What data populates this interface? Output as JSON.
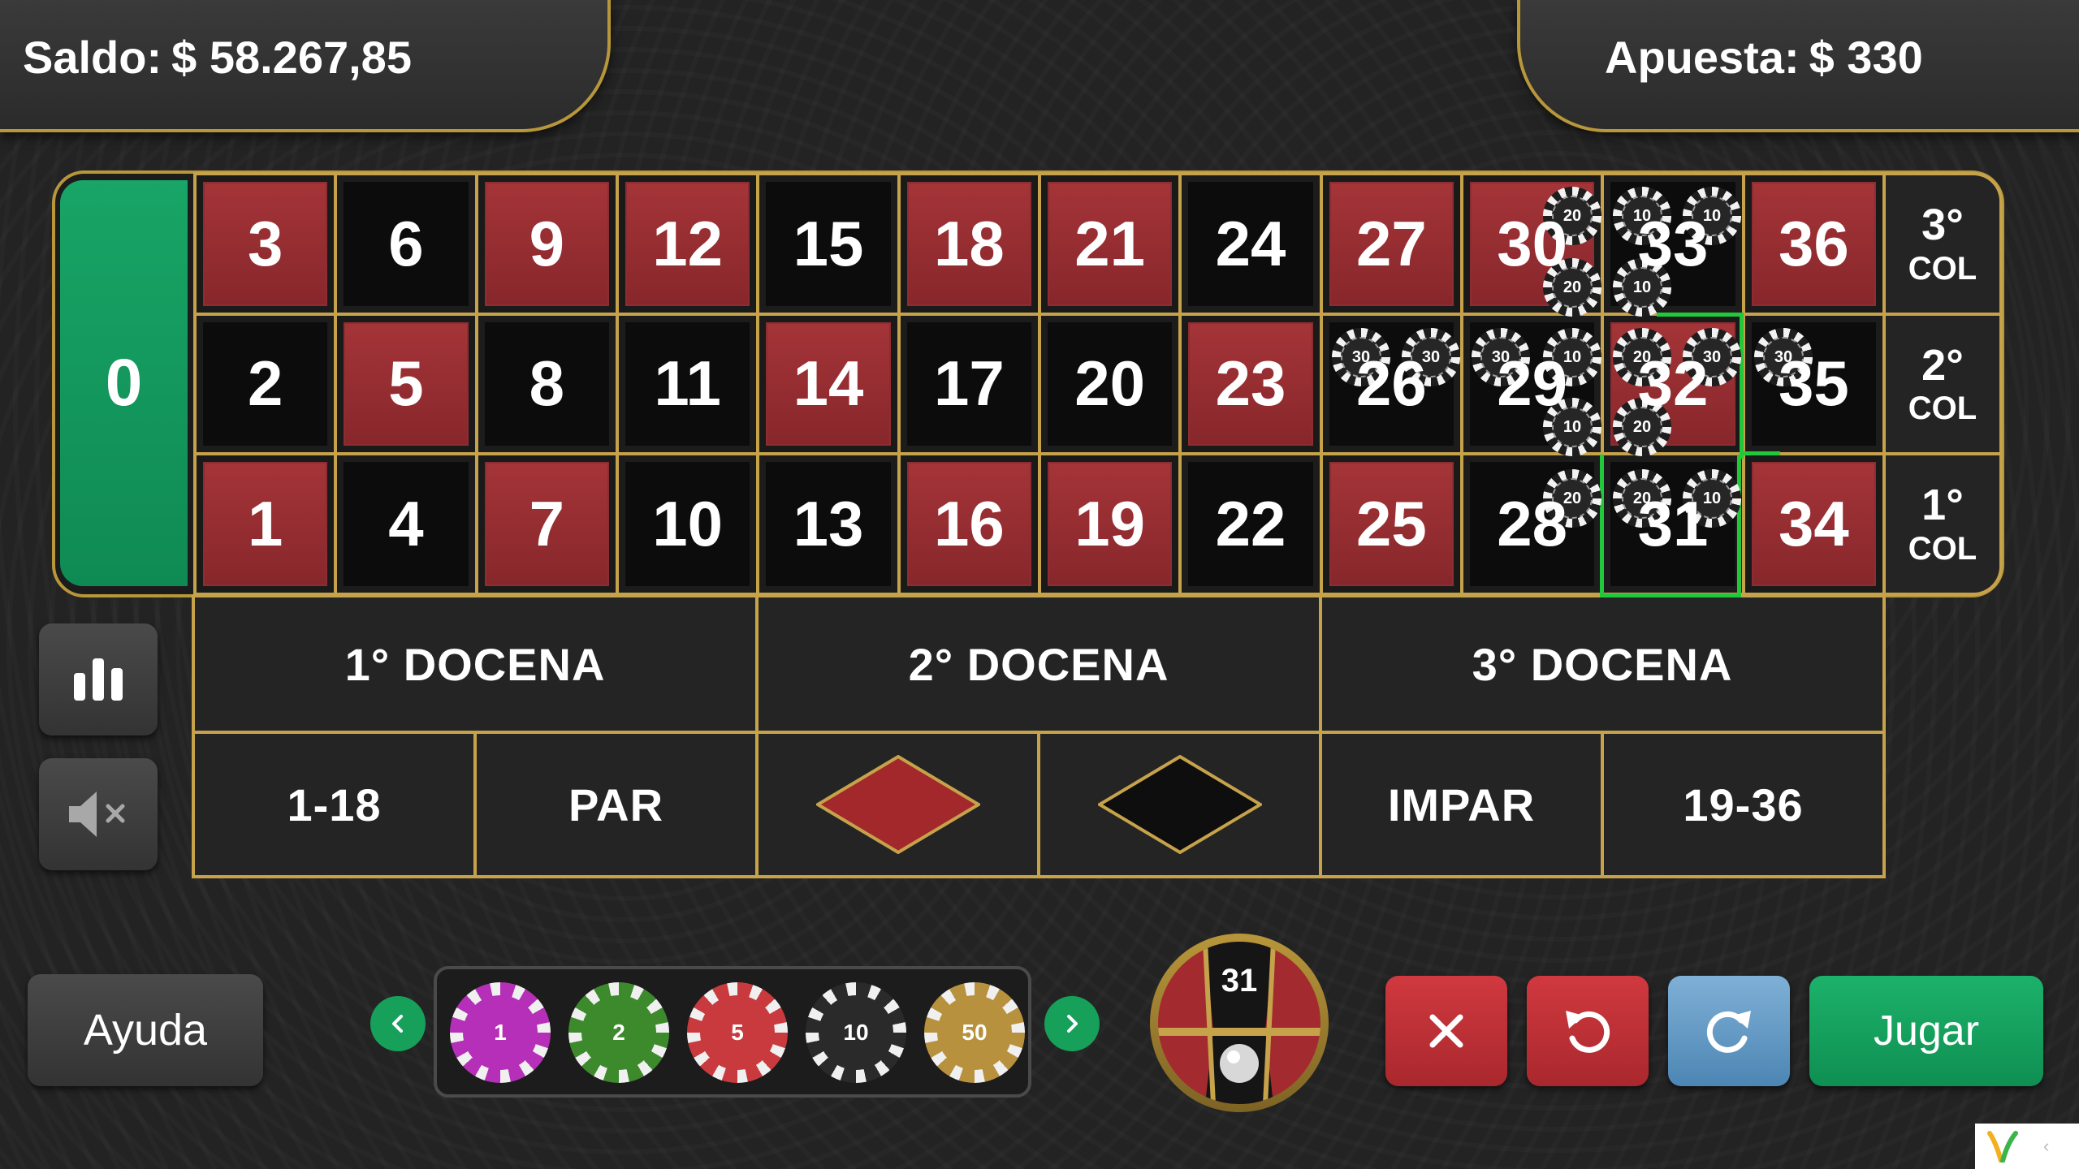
{
  "header": {
    "balance_label": "Saldo:",
    "balance_value": "$ 58.267,85",
    "bet_label": "Apuesta:",
    "bet_value": "$ 330"
  },
  "table": {
    "zero": "0",
    "rows": [
      [
        {
          "n": "3",
          "c": "red"
        },
        {
          "n": "6",
          "c": "black"
        },
        {
          "n": "9",
          "c": "red"
        },
        {
          "n": "12",
          "c": "red"
        },
        {
          "n": "15",
          "c": "black"
        },
        {
          "n": "18",
          "c": "red"
        },
        {
          "n": "21",
          "c": "red"
        },
        {
          "n": "24",
          "c": "black"
        },
        {
          "n": "27",
          "c": "red"
        },
        {
          "n": "30",
          "c": "red"
        },
        {
          "n": "33",
          "c": "black"
        },
        {
          "n": "36",
          "c": "red"
        }
      ],
      [
        {
          "n": "2",
          "c": "black"
        },
        {
          "n": "5",
          "c": "red"
        },
        {
          "n": "8",
          "c": "black"
        },
        {
          "n": "11",
          "c": "black"
        },
        {
          "n": "14",
          "c": "red"
        },
        {
          "n": "17",
          "c": "black"
        },
        {
          "n": "20",
          "c": "black"
        },
        {
          "n": "23",
          "c": "red"
        },
        {
          "n": "26",
          "c": "black"
        },
        {
          "n": "29",
          "c": "black"
        },
        {
          "n": "32",
          "c": "red"
        },
        {
          "n": "35",
          "c": "black"
        }
      ],
      [
        {
          "n": "1",
          "c": "red"
        },
        {
          "n": "4",
          "c": "black"
        },
        {
          "n": "7",
          "c": "red"
        },
        {
          "n": "10",
          "c": "black"
        },
        {
          "n": "13",
          "c": "black"
        },
        {
          "n": "16",
          "c": "red"
        },
        {
          "n": "19",
          "c": "red"
        },
        {
          "n": "22",
          "c": "black"
        },
        {
          "n": "25",
          "c": "red"
        },
        {
          "n": "28",
          "c": "black"
        },
        {
          "n": "31",
          "c": "black"
        },
        {
          "n": "34",
          "c": "red"
        }
      ]
    ],
    "columns": [
      {
        "num": "3°",
        "label": "COL"
      },
      {
        "num": "2°",
        "label": "COL"
      },
      {
        "num": "1°",
        "label": "COL"
      }
    ],
    "dozens": [
      "1° DOCENA",
      "2° DOCENA",
      "3° DOCENA"
    ],
    "outside": {
      "low": "1-18",
      "even": "PAR",
      "odd": "IMPAR",
      "high": "19-36",
      "red_color": "#a3282c",
      "black_color": "#0e0e0e"
    },
    "placed_chips": [
      "20",
      "10",
      "10",
      "20",
      "10",
      "30",
      "30",
      "30",
      "10",
      "20",
      "30",
      "30",
      "10",
      "20",
      "20",
      "20",
      "10"
    ]
  },
  "chips": {
    "values": [
      "1",
      "2",
      "5",
      "10",
      "50"
    ],
    "colors": [
      "#b52fb8",
      "#3d8a2d",
      "#c93a3f",
      "#2a2a2a",
      "#b8913e"
    ]
  },
  "last_result": "31",
  "buttons": {
    "help": "Ayuda",
    "play": "Jugar",
    "clear_icon": "close-icon",
    "undo_icon": "undo-icon",
    "redo_icon": "redo-icon",
    "stats_icon": "bar-chart-icon",
    "mute_icon": "speaker-muted-icon"
  },
  "colors": {
    "gold": "#b8963a",
    "green": "#129a5e",
    "red": "#a3282c",
    "blue": "#5f97c4"
  }
}
